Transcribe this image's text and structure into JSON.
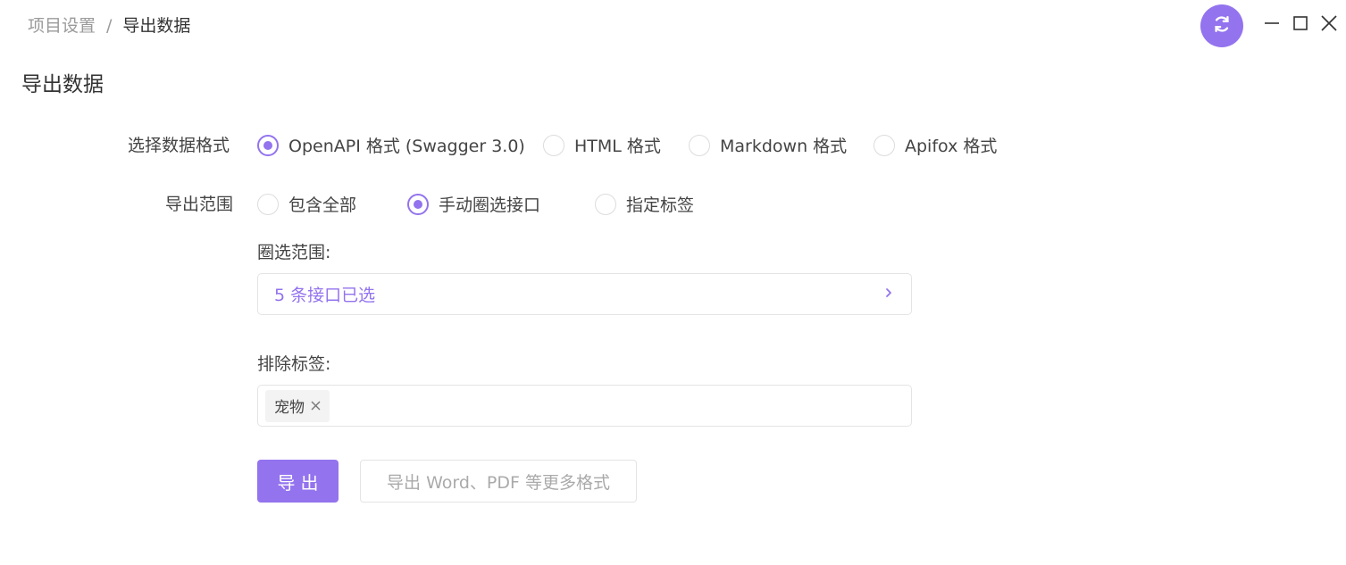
{
  "breadcrumb": {
    "parent": "项目设置",
    "separator": "/",
    "current": "导出数据"
  },
  "window": {
    "sync_icon": "sync-icon",
    "minimize_icon": "minimize-icon",
    "maximize_icon": "maximize-icon",
    "close_icon": "close-icon"
  },
  "page": {
    "title": "导出数据"
  },
  "format": {
    "label": "选择数据格式",
    "options": [
      {
        "label": "OpenAPI 格式 (Swagger 3.0)",
        "checked": true
      },
      {
        "label": "HTML 格式",
        "checked": false
      },
      {
        "label": "Markdown 格式",
        "checked": false
      },
      {
        "label": "Apifox 格式",
        "checked": false
      }
    ]
  },
  "scope": {
    "label": "导出范围",
    "options": [
      {
        "label": "包含全部",
        "checked": false
      },
      {
        "label": "手动圈选接口",
        "checked": true
      },
      {
        "label": "指定标签",
        "checked": false
      }
    ]
  },
  "selection": {
    "label": "圈选范围:",
    "value": "5 条接口已选",
    "icon": "chevron-right-icon"
  },
  "exclude": {
    "label": "排除标签:",
    "tags": [
      {
        "label": "宠物"
      }
    ]
  },
  "actions": {
    "export_label": "导出",
    "more_label": "导出 Word、PDF 等更多格式"
  },
  "colors": {
    "accent": "#9373ee",
    "text": "#444444",
    "muted": "#9a9a9a",
    "border": "#e4e4e4"
  }
}
